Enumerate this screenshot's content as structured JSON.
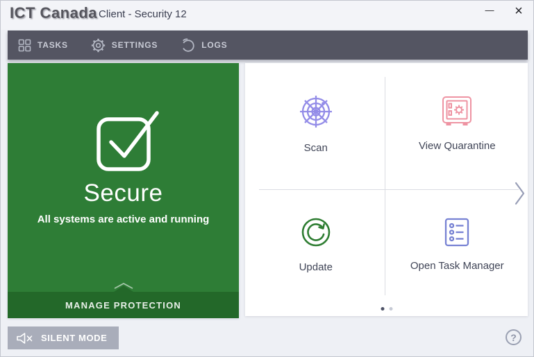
{
  "titlebar": {
    "logo": "ICT Canada",
    "title": "Client - Security 12",
    "minimize_glyph": "—",
    "close_glyph": "×"
  },
  "toolbar": {
    "items": [
      {
        "id": "tasks",
        "label": "TASKS",
        "icon": "grid-icon"
      },
      {
        "id": "settings",
        "label": "SETTINGS",
        "icon": "gear-icon"
      },
      {
        "id": "logs",
        "label": "LOGS",
        "icon": "pie-chart-icon"
      }
    ]
  },
  "status_panel": {
    "state": "Secure",
    "message": "All systems are active and running",
    "manage_button": "MANAGE PROTECTION",
    "icon": "checkmark-icon"
  },
  "actions_panel": {
    "tiles": [
      {
        "label": "Scan",
        "icon": "radar-icon"
      },
      {
        "label": "View Quarantine",
        "icon": "safe-icon"
      },
      {
        "label": "Update",
        "icon": "refresh-icon"
      },
      {
        "label": "Open Task Manager",
        "icon": "task-list-icon"
      }
    ],
    "pagination": {
      "total": 2,
      "active_page": 1
    }
  },
  "footer": {
    "silent_mode_label": "SILENT MODE",
    "help_glyph": "?"
  },
  "colors": {
    "status_green": "#2e7d36",
    "status_green_dark": "#236829",
    "toolbar_bg": "#545562",
    "scan_icon": "#938ce8",
    "quarantine_icon": "#ee93a2",
    "update_icon": "#2e7d32",
    "task_manager_icon": "#7681d3",
    "silent_button_bg": "#a9adba"
  }
}
